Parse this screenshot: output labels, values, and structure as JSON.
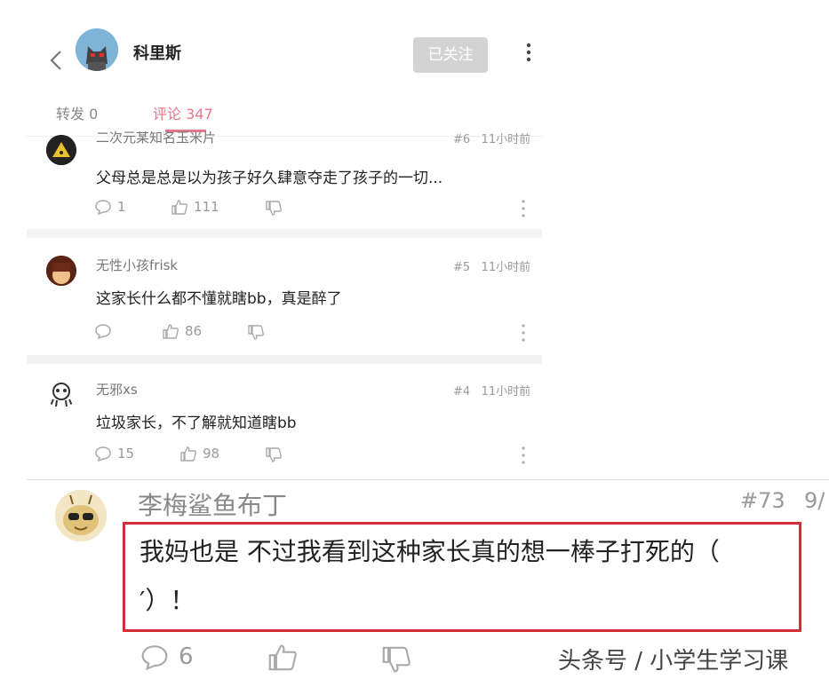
{
  "header": {
    "username": "科里斯",
    "follow_label": "已关注"
  },
  "tabs": {
    "forward": "转发 0",
    "comment": "评论 347"
  },
  "comments": [
    {
      "name": "二次元某知名玉米片",
      "floor": "#6",
      "time": "11小时前",
      "text": "父母总是总是以为孩子好久肆意夺走了孩子的一切...",
      "replies": "1",
      "likes": "111"
    },
    {
      "name": "无性小孩frisk",
      "floor": "#5",
      "time": "11小时前",
      "text": "这家长什么都不懂就瞎bb，真是醉了",
      "replies": "",
      "likes": "86"
    },
    {
      "name": "无邪xs",
      "floor": "#4",
      "time": "11小时前",
      "text": "垃圾家长，不了解就知道瞎bb",
      "replies": "15",
      "likes": "98"
    }
  ],
  "highlight": {
    "name": "李梅鲨鱼布丁",
    "floor": "#73",
    "time": "9/",
    "text_line1": "我妈也是 不过我看到这种家长真的想一棒子打死的（",
    "text_line2": "′）！",
    "replies": "6"
  },
  "watermark": "头条号 / 小学生学习课",
  "colors": {
    "accent": "#e8768a",
    "highlight_border": "#d42d38",
    "follow_bg": "#d3d3d3"
  }
}
